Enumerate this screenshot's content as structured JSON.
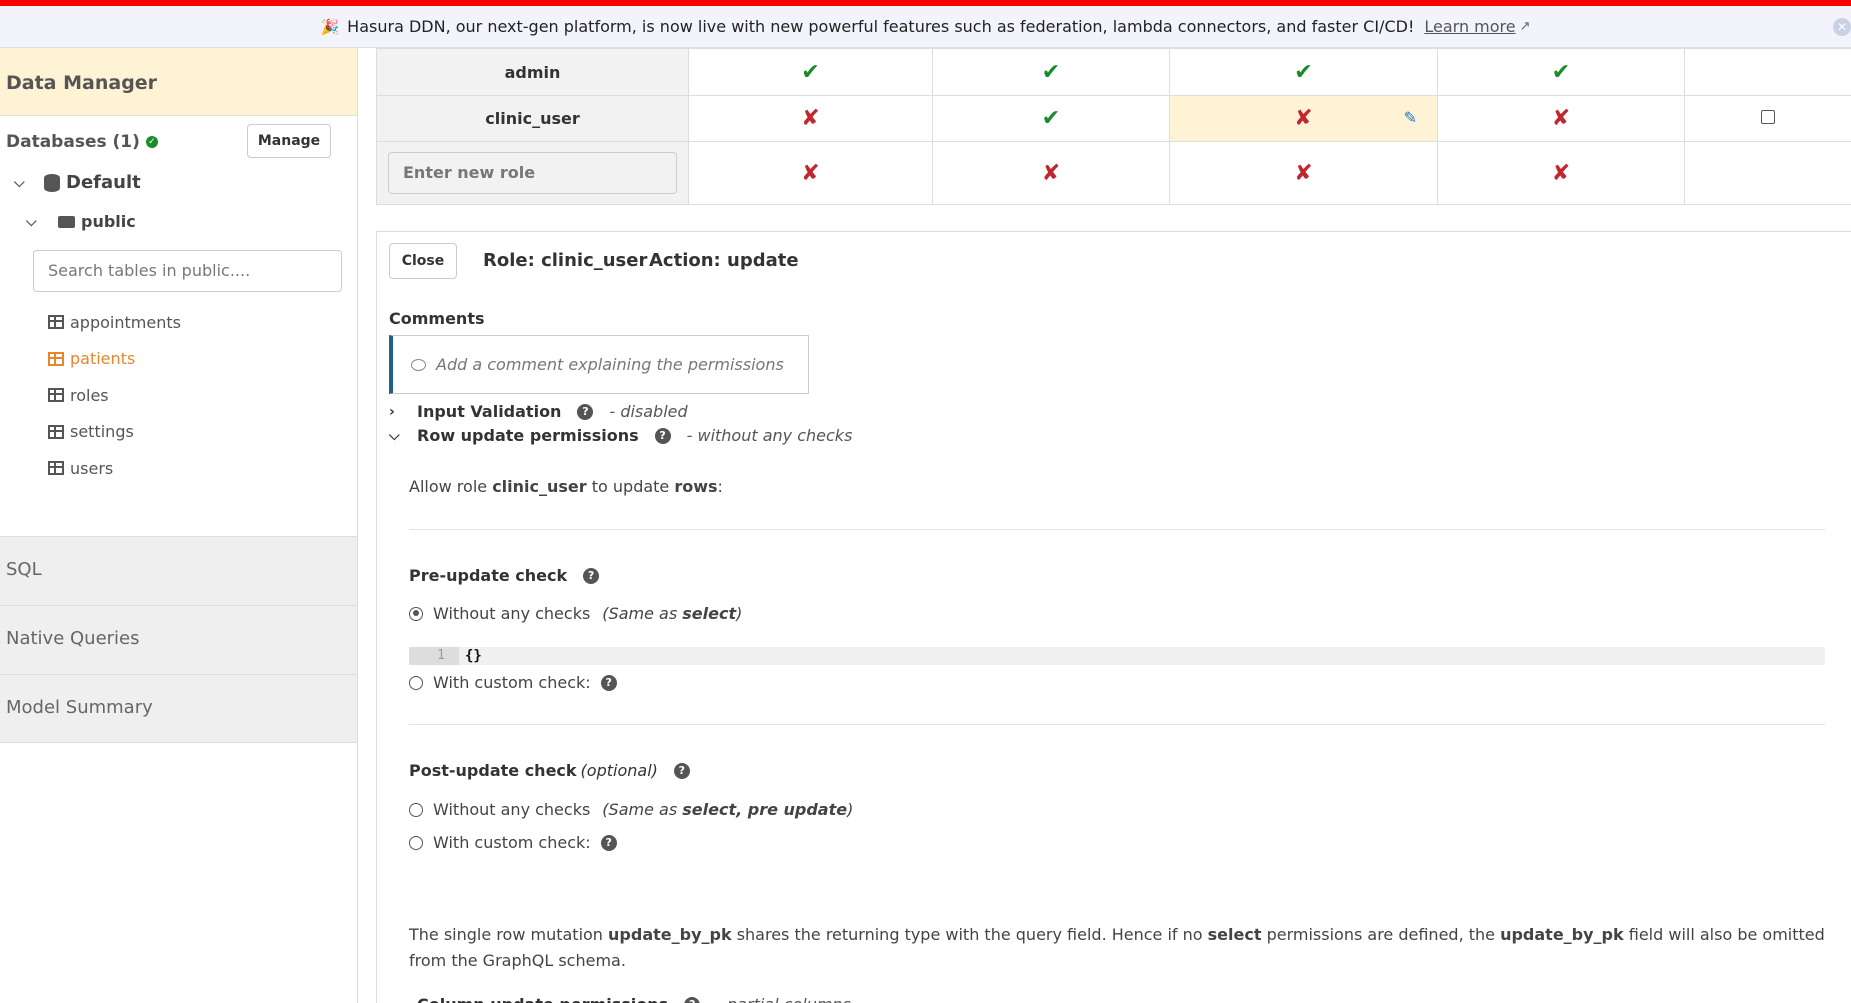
{
  "banner": {
    "text": "Hasura DDN, our next-gen platform, is now live with new powerful features such as federation, lambda connectors, and faster CI/CD!",
    "learn_more": "Learn more"
  },
  "sidebar": {
    "title": "Data Manager",
    "databases_label": "Databases (1)",
    "manage_label": "Manage",
    "db_name": "Default",
    "schema_name": "public",
    "search_placeholder": "Search tables in public....",
    "tables": [
      {
        "label": "appointments",
        "active": false
      },
      {
        "label": "patients",
        "active": true
      },
      {
        "label": "roles",
        "active": false
      },
      {
        "label": "settings",
        "active": false
      },
      {
        "label": "users",
        "active": false
      }
    ],
    "sections": [
      "SQL",
      "Native Queries",
      "Model Summary"
    ]
  },
  "permissions_table": {
    "rows": [
      {
        "role": "admin",
        "cells": [
          "check",
          "check",
          "check",
          "check",
          ""
        ]
      },
      {
        "role": "clinic_user",
        "cells": [
          "cross",
          "check",
          "cross",
          "cross",
          "checkbox"
        ],
        "selected_col": 2
      },
      {
        "role": "",
        "cells": [
          "cross",
          "cross",
          "cross",
          "cross",
          ""
        ]
      }
    ],
    "new_role_placeholder": "Enter new role"
  },
  "panel": {
    "close_label": "Close",
    "role_text": "Role: clinic_user",
    "action_text": "Action: update",
    "comments_label": "Comments",
    "comment_placeholder": "Add a comment explaining the permissions",
    "input_validation": {
      "title": "Input Validation",
      "status": "- disabled"
    },
    "row_update": {
      "title": "Row update permissions",
      "status": "- without any checks"
    },
    "allow_prefix": "Allow role ",
    "allow_role": "clinic_user",
    "allow_mid": " to update ",
    "allow_rows": "rows",
    "allow_suffix": ":",
    "pre_update": {
      "title": "Pre-update check",
      "option1": "Without any checks",
      "option1_hint_prefix": "(Same as ",
      "option1_hint_bold": "select",
      "option1_hint_suffix": ")",
      "code_line": "1",
      "code": "{}",
      "option2": "With custom check:"
    },
    "post_update": {
      "title": "Post-update check",
      "optional": "(optional)",
      "option1": "Without any checks",
      "option1_hint_prefix": "(Same as ",
      "option1_hint_bold": "select, pre update",
      "option1_hint_suffix": ")",
      "option2": "With custom check:"
    },
    "note": {
      "p1": "The single row mutation ",
      "b1": "update_by_pk",
      "p2": " shares the returning type with the query field. Hence if no ",
      "b2": "select",
      "p3": " permissions are defined, the ",
      "b3": "update_by_pk",
      "p4": " field will also be omitted from the GraphQL schema."
    },
    "column_update": {
      "title": "Column update permissions",
      "status": "- partial columns"
    }
  }
}
